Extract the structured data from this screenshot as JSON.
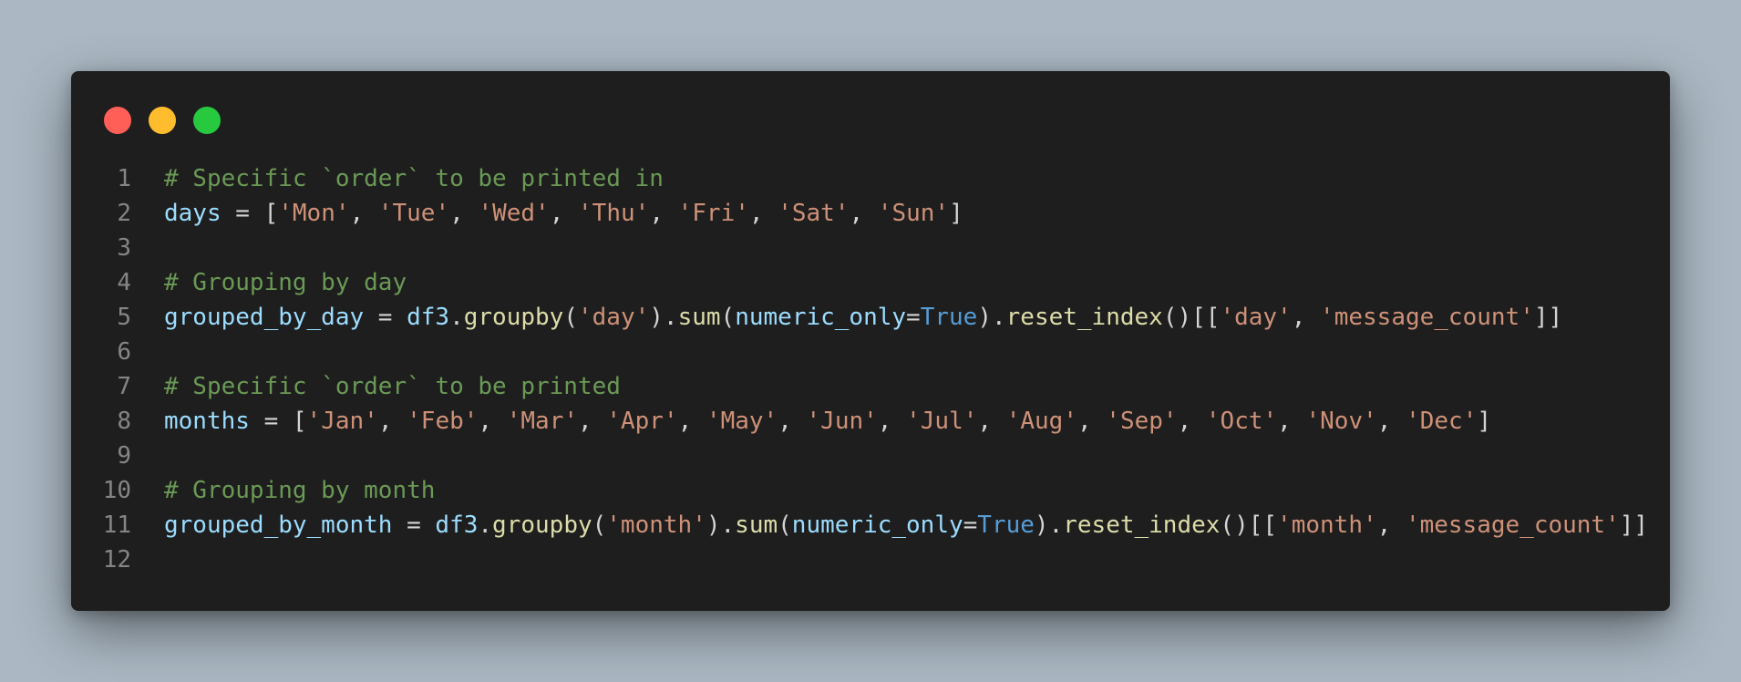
{
  "window": {
    "controls": {
      "close_color": "#ff5f56",
      "minimize_color": "#ffbd2e",
      "maximize_color": "#27c93f"
    }
  },
  "code": {
    "lines": [
      {
        "number": "1",
        "tokens": [
          {
            "type": "comment",
            "text": "# Specific `order` to be printed in"
          }
        ]
      },
      {
        "number": "2",
        "tokens": [
          {
            "type": "variable",
            "text": "days"
          },
          {
            "type": "punct",
            "text": " = ["
          },
          {
            "type": "string",
            "text": "'Mon'"
          },
          {
            "type": "punct",
            "text": ", "
          },
          {
            "type": "string",
            "text": "'Tue'"
          },
          {
            "type": "punct",
            "text": ", "
          },
          {
            "type": "string",
            "text": "'Wed'"
          },
          {
            "type": "punct",
            "text": ", "
          },
          {
            "type": "string",
            "text": "'Thu'"
          },
          {
            "type": "punct",
            "text": ", "
          },
          {
            "type": "string",
            "text": "'Fri'"
          },
          {
            "type": "punct",
            "text": ", "
          },
          {
            "type": "string",
            "text": "'Sat'"
          },
          {
            "type": "punct",
            "text": ", "
          },
          {
            "type": "string",
            "text": "'Sun'"
          },
          {
            "type": "punct",
            "text": "]"
          }
        ]
      },
      {
        "number": "3",
        "tokens": []
      },
      {
        "number": "4",
        "tokens": [
          {
            "type": "comment",
            "text": "# Grouping by day"
          }
        ]
      },
      {
        "number": "5",
        "tokens": [
          {
            "type": "variable",
            "text": "grouped_by_day"
          },
          {
            "type": "punct",
            "text": " = "
          },
          {
            "type": "variable",
            "text": "df3"
          },
          {
            "type": "punct",
            "text": "."
          },
          {
            "type": "function",
            "text": "groupby"
          },
          {
            "type": "punct",
            "text": "("
          },
          {
            "type": "string",
            "text": "'day'"
          },
          {
            "type": "punct",
            "text": ")."
          },
          {
            "type": "function",
            "text": "sum"
          },
          {
            "type": "punct",
            "text": "("
          },
          {
            "type": "variable",
            "text": "numeric_only"
          },
          {
            "type": "punct",
            "text": "="
          },
          {
            "type": "keyword",
            "text": "True"
          },
          {
            "type": "punct",
            "text": ")."
          },
          {
            "type": "function",
            "text": "reset_index"
          },
          {
            "type": "punct",
            "text": "()[["
          },
          {
            "type": "string",
            "text": "'day'"
          },
          {
            "type": "punct",
            "text": ", "
          },
          {
            "type": "string",
            "text": "'message_count'"
          },
          {
            "type": "punct",
            "text": "]]"
          }
        ]
      },
      {
        "number": "6",
        "tokens": []
      },
      {
        "number": "7",
        "tokens": [
          {
            "type": "comment",
            "text": "# Specific `order` to be printed"
          }
        ]
      },
      {
        "number": "8",
        "tokens": [
          {
            "type": "variable",
            "text": "months"
          },
          {
            "type": "punct",
            "text": " = ["
          },
          {
            "type": "string",
            "text": "'Jan'"
          },
          {
            "type": "punct",
            "text": ", "
          },
          {
            "type": "string",
            "text": "'Feb'"
          },
          {
            "type": "punct",
            "text": ", "
          },
          {
            "type": "string",
            "text": "'Mar'"
          },
          {
            "type": "punct",
            "text": ", "
          },
          {
            "type": "string",
            "text": "'Apr'"
          },
          {
            "type": "punct",
            "text": ", "
          },
          {
            "type": "string",
            "text": "'May'"
          },
          {
            "type": "punct",
            "text": ", "
          },
          {
            "type": "string",
            "text": "'Jun'"
          },
          {
            "type": "punct",
            "text": ", "
          },
          {
            "type": "string",
            "text": "'Jul'"
          },
          {
            "type": "punct",
            "text": ", "
          },
          {
            "type": "string",
            "text": "'Aug'"
          },
          {
            "type": "punct",
            "text": ", "
          },
          {
            "type": "string",
            "text": "'Sep'"
          },
          {
            "type": "punct",
            "text": ", "
          },
          {
            "type": "string",
            "text": "'Oct'"
          },
          {
            "type": "punct",
            "text": ", "
          },
          {
            "type": "string",
            "text": "'Nov'"
          },
          {
            "type": "punct",
            "text": ", "
          },
          {
            "type": "string",
            "text": "'Dec'"
          },
          {
            "type": "punct",
            "text": "]"
          }
        ]
      },
      {
        "number": "9",
        "tokens": []
      },
      {
        "number": "10",
        "tokens": [
          {
            "type": "comment",
            "text": "# Grouping by month"
          }
        ]
      },
      {
        "number": "11",
        "tokens": [
          {
            "type": "variable",
            "text": "grouped_by_month"
          },
          {
            "type": "punct",
            "text": " = "
          },
          {
            "type": "variable",
            "text": "df3"
          },
          {
            "type": "punct",
            "text": "."
          },
          {
            "type": "function",
            "text": "groupby"
          },
          {
            "type": "punct",
            "text": "("
          },
          {
            "type": "string",
            "text": "'month'"
          },
          {
            "type": "punct",
            "text": ")."
          },
          {
            "type": "function",
            "text": "sum"
          },
          {
            "type": "punct",
            "text": "("
          },
          {
            "type": "variable",
            "text": "numeric_only"
          },
          {
            "type": "punct",
            "text": "="
          },
          {
            "type": "keyword",
            "text": "True"
          },
          {
            "type": "punct",
            "text": ")."
          },
          {
            "type": "function",
            "text": "reset_index"
          },
          {
            "type": "punct",
            "text": "()[["
          },
          {
            "type": "string",
            "text": "'month'"
          },
          {
            "type": "punct",
            "text": ", "
          },
          {
            "type": "string",
            "text": "'message_count'"
          },
          {
            "type": "punct",
            "text": "]]"
          }
        ]
      },
      {
        "number": "12",
        "tokens": []
      }
    ]
  }
}
